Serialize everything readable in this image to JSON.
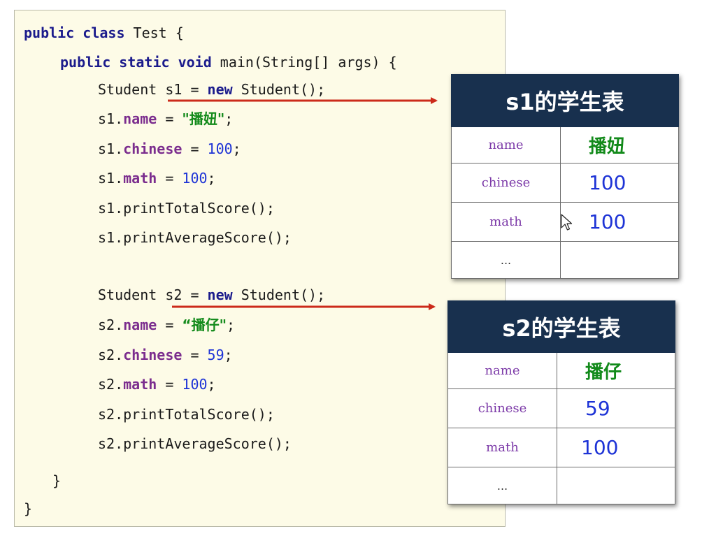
{
  "code": {
    "class_decl": {
      "kw": "public class",
      "rest": " Test {"
    },
    "main_decl": {
      "kw": "public static void",
      "rest": " main(String[] args) {"
    },
    "s1": {
      "new_pre": "Student s1 = ",
      "new_kw": "new",
      "new_post": " Student();",
      "name_obj": "s1.",
      "name_field": "name",
      "name_eq": " = ",
      "name_val": "\"播妞\"",
      "name_end": ";",
      "chinese_obj": "s1.",
      "chinese_field": "chinese",
      "chinese_eq": " = ",
      "chinese_val": "100",
      "chinese_end": ";",
      "math_obj": "s1.",
      "math_field": "math",
      "math_eq": " = ",
      "math_val": "100",
      "math_end": ";",
      "total_call": "s1.printTotalScore();",
      "avg_call": "s1.printAverageScore();"
    },
    "s2": {
      "new_pre": "Student s2 = ",
      "new_kw": "new",
      "new_post": " Student();",
      "name_obj": "s2.",
      "name_field": "name",
      "name_eq": " = ",
      "name_val": "“播仔\"",
      "name_end": ";",
      "chinese_obj": "s2.",
      "chinese_field": "chinese",
      "chinese_eq": " = ",
      "chinese_val": "59",
      "chinese_end": ";",
      "math_obj": "s2.",
      "math_field": "math",
      "math_eq": " = ",
      "math_val": "100",
      "math_end": ";",
      "total_call": "s2.printTotalScore();",
      "avg_call": "s2.printAverageScore();"
    },
    "close_method": "}",
    "close_class": "}"
  },
  "tables": [
    {
      "title": "s1的学生表",
      "rows": [
        {
          "key": "name",
          "value": "播妞"
        },
        {
          "key": "chinese",
          "value": "100"
        },
        {
          "key": "math",
          "value": "100"
        },
        {
          "key": "...",
          "value": ""
        }
      ]
    },
    {
      "title": "s2的学生表",
      "rows": [
        {
          "key": "name",
          "value": "播仔"
        },
        {
          "key": "chinese",
          "value": "59"
        },
        {
          "key": "math",
          "value": "100"
        },
        {
          "key": "...",
          "value": ""
        }
      ]
    }
  ],
  "colors": {
    "panel_bg": "#fdfbe7",
    "keyword": "#1b1b8c",
    "field": "#7b2d8e",
    "number": "#1d33d6",
    "string": "#128a1a",
    "table_header": "#18304e",
    "arrow": "#cc2a1a"
  },
  "icons": {
    "cursor": "mouse-pointer-icon"
  }
}
